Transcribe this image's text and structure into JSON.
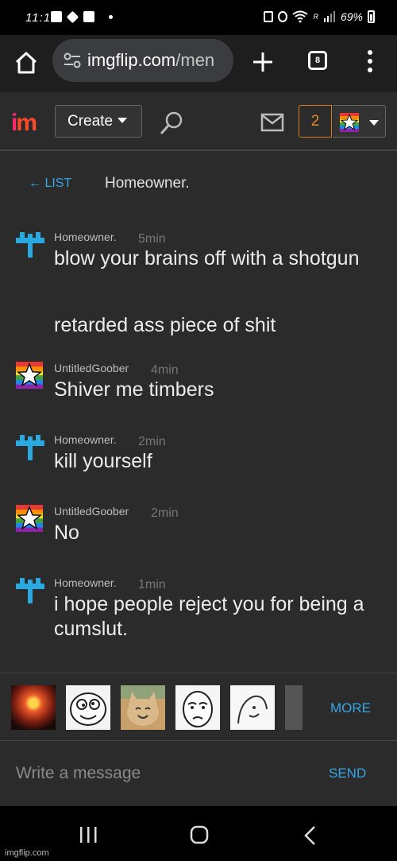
{
  "status_bar": {
    "time": "11:19",
    "battery": "69%",
    "signal_letter": "R"
  },
  "browser": {
    "url_host": "imgflip.com",
    "url_path": "/men",
    "tab_count": "8"
  },
  "header": {
    "logo_i": "i",
    "logo_m": "m",
    "create_label": "Create",
    "notif_count": "2"
  },
  "conversation": {
    "back_label": "← LIST",
    "title": "Homeowner."
  },
  "messages": [
    {
      "user": "Homeowner.",
      "time": "5min",
      "lines": [
        "blow your brains off with a shotgun",
        "retarded ass piece of shit"
      ]
    },
    {
      "user": "UntitledGoober",
      "time": "4min",
      "lines": [
        "Shiver me timbers"
      ]
    },
    {
      "user": "Homeowner.",
      "time": "2min",
      "lines": [
        "kill yourself"
      ]
    },
    {
      "user": "UntitledGoober",
      "time": "2min",
      "lines": [
        "No"
      ]
    },
    {
      "user": "Homeowner.",
      "time": "1min",
      "lines": [
        "i hope people reject you for being a cumslut."
      ]
    }
  ],
  "memes": {
    "more_label": "MORE"
  },
  "composer": {
    "placeholder": "Write a message",
    "send_label": "SEND"
  },
  "watermark": "imgflip.com",
  "colors": {
    "accent": "#36a6e6",
    "notif": "#e38a2b",
    "homeowner_avatar": "#29a9e0"
  }
}
